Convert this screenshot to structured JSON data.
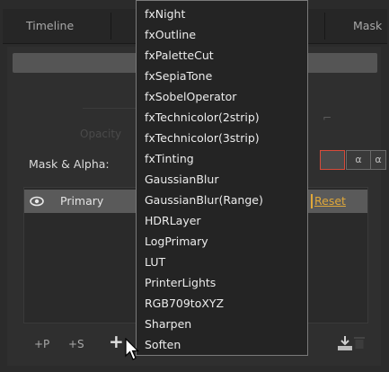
{
  "tabs": [
    {
      "label": "Timeline"
    },
    {
      "label": "Mask"
    }
  ],
  "opacity_label": "Opacity",
  "mask_alpha": {
    "label": "Mask & Alpha:",
    "buttons": [
      "α",
      "α"
    ]
  },
  "layers": {
    "primary_label": "Primary",
    "reset_label": "Reset"
  },
  "bottom_bar": {
    "add_p_label": "+P",
    "add_s_label": "+S",
    "add_label": "+"
  },
  "dropdown": {
    "items": [
      "fxNight",
      "fxOutline",
      "fxPaletteCut",
      "fxSepiaTone",
      "fxSobelOperator",
      "fxTechnicolor(2strip)",
      "fxTechnicolor(3strip)",
      "fxTinting",
      "GaussianBlur",
      "GaussianBlur(Range)",
      "HDRLayer",
      "LogPrimary",
      "LUT",
      "PrinterLights",
      "RGB709toXYZ",
      "Sharpen",
      "Soften"
    ]
  },
  "colors": {
    "accent": "#e0a83a",
    "alpha_active_border": "#d84b3a",
    "menu_bg": "#242424"
  },
  "icons": [
    "eye-icon",
    "download-icon",
    "trash-icon",
    "mouse-cursor-icon"
  ]
}
